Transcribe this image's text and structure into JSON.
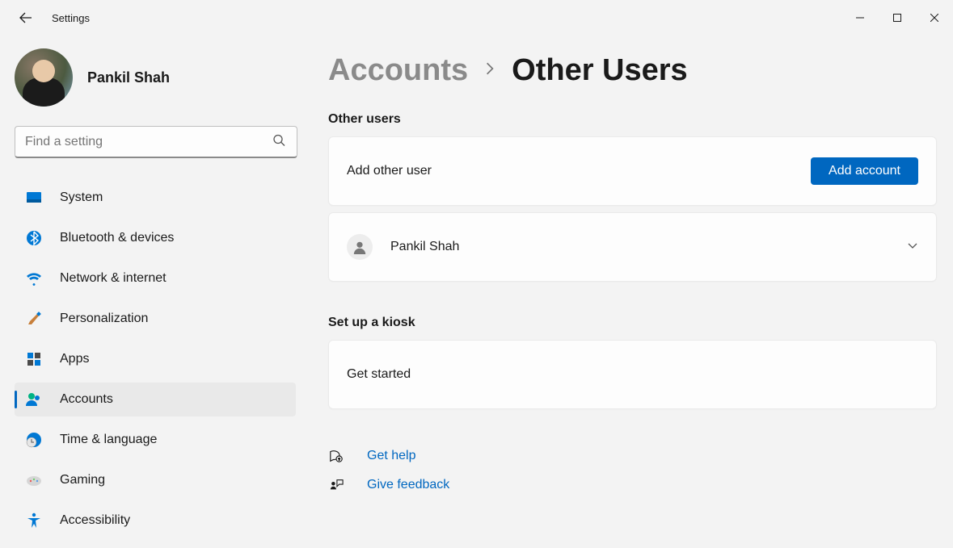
{
  "window": {
    "title": "Settings"
  },
  "profile": {
    "name": "Pankil Shah"
  },
  "search": {
    "placeholder": "Find a setting"
  },
  "nav": [
    {
      "label": "System"
    },
    {
      "label": "Bluetooth & devices"
    },
    {
      "label": "Network & internet"
    },
    {
      "label": "Personalization"
    },
    {
      "label": "Apps"
    },
    {
      "label": "Accounts"
    },
    {
      "label": "Time & language"
    },
    {
      "label": "Gaming"
    },
    {
      "label": "Accessibility"
    }
  ],
  "breadcrumb": {
    "parent": "Accounts",
    "current": "Other Users"
  },
  "sections": {
    "other_users": {
      "heading": "Other users",
      "add_row_label": "Add other user",
      "add_button": "Add account",
      "user_row": {
        "name": "Pankil Shah"
      }
    },
    "kiosk": {
      "heading": "Set up a kiosk",
      "row_label": "Get started"
    }
  },
  "help": {
    "get_help": "Get help",
    "feedback": "Give feedback"
  }
}
